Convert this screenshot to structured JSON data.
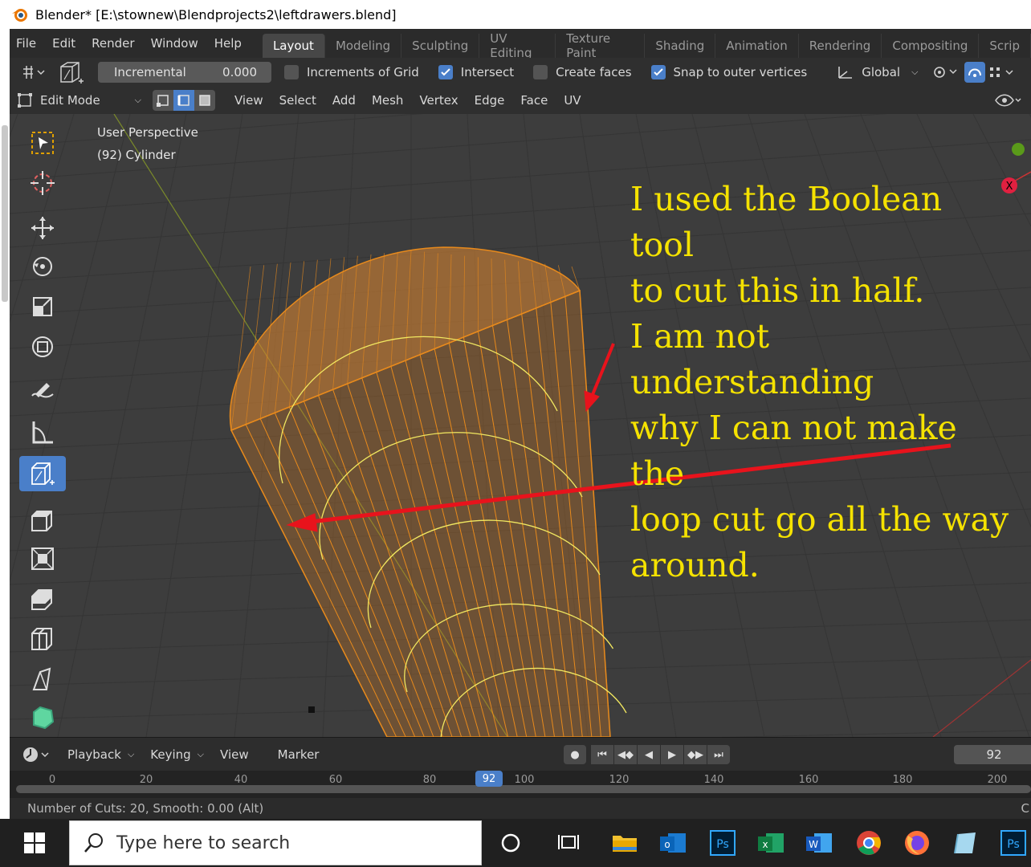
{
  "window": {
    "title": "Blender* [E:\\stownew\\Blendprojects2\\leftdrawers.blend]"
  },
  "menu": {
    "items": [
      "File",
      "Edit",
      "Render",
      "Window",
      "Help"
    ]
  },
  "workspaces": {
    "tabs": [
      "Layout",
      "Modeling",
      "Sculpting",
      "UV Editing",
      "Texture Paint",
      "Shading",
      "Animation",
      "Rendering",
      "Compositing",
      "Scrip"
    ],
    "active": "Layout"
  },
  "snap_header": {
    "increment_label": "Incremental",
    "increment_value": "0.000",
    "checkboxes": [
      {
        "label": "Increments of Grid",
        "checked": false
      },
      {
        "label": "Intersect",
        "checked": true
      },
      {
        "label": "Create faces",
        "checked": false
      },
      {
        "label": "Snap to outer vertices",
        "checked": true
      }
    ],
    "orientation": "Global"
  },
  "mode_header": {
    "mode": "Edit Mode",
    "menus": [
      "View",
      "Select",
      "Add",
      "Mesh",
      "Vertex",
      "Edge",
      "Face",
      "UV"
    ]
  },
  "viewport": {
    "view_name": "User Perspective",
    "object_info": "(92) Cylinder",
    "axis_x_label": "X"
  },
  "annotation": {
    "lines": [
      "I used the Boolean tool",
      "to cut this in half.",
      "I am not understanding",
      "why I can not make the",
      "loop cut go all the way",
      "around."
    ]
  },
  "tools": [
    "select-box",
    "cursor",
    "move",
    "rotate",
    "scale",
    "transform",
    "annotate",
    "measure",
    "add-cube",
    "extrude",
    "inset",
    "bevel",
    "loop-cut",
    "knife",
    "poly-build"
  ],
  "timeline": {
    "menus": [
      "Playback",
      "Keying",
      "View",
      "Marker"
    ],
    "current_frame": "92",
    "ruler_marks": [
      "0",
      "20",
      "40",
      "60",
      "80",
      "100",
      "120",
      "140",
      "160",
      "180",
      "200"
    ]
  },
  "status_bar": {
    "text": "Number of Cuts: 20, Smooth: 0.00 (Alt)",
    "right": "C"
  },
  "taskbar": {
    "search_placeholder": "Type here to search"
  },
  "colors": {
    "accent": "#4a7fc9",
    "annotation": "#f5e200",
    "arrow": "#e8131c",
    "mesh_orange": "#e88a1c"
  }
}
